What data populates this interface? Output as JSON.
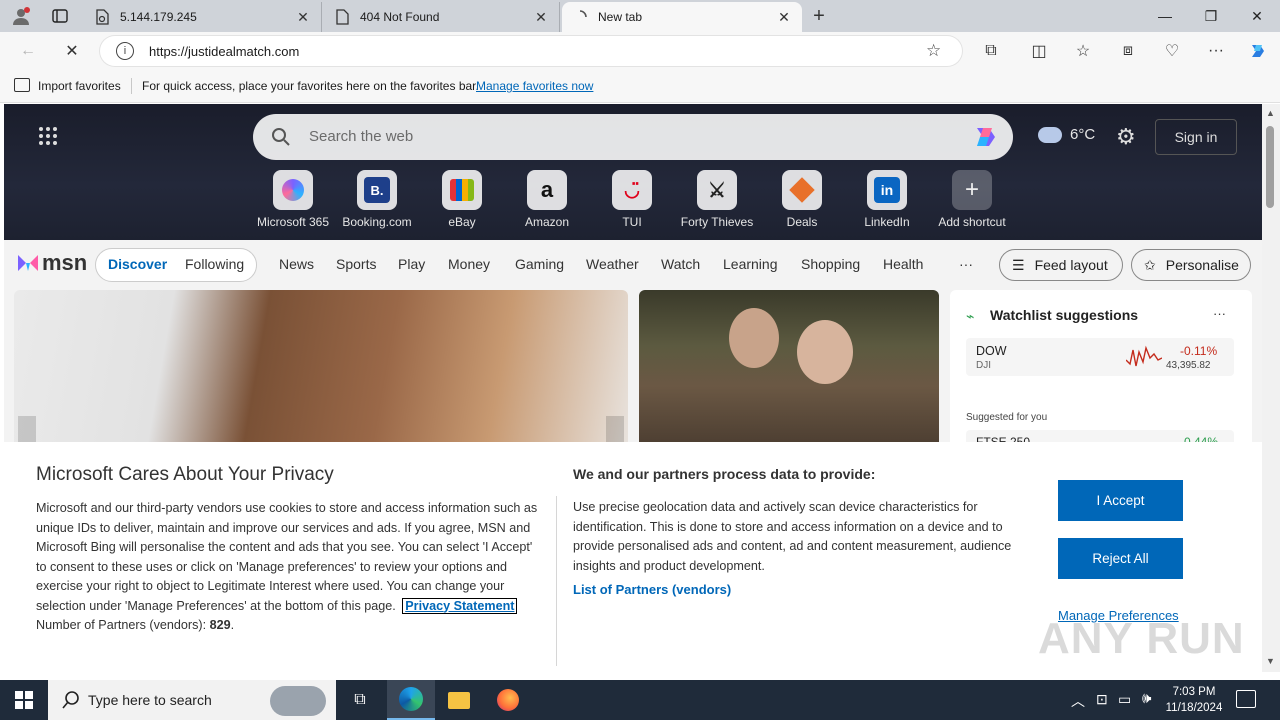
{
  "tabs": [
    {
      "label": "5.144.179.245"
    },
    {
      "label": "404 Not Found"
    },
    {
      "label": "New tab"
    }
  ],
  "toolbar": {
    "url": "https://justidealmatch.com"
  },
  "favorites_bar": {
    "import_label": "Import favorites",
    "hint": "For quick access, place your favorites here on the favorites bar.",
    "manage_link": "Manage favorites now"
  },
  "msn": {
    "search_placeholder": "Search the web",
    "weather_temp": "6°C",
    "sign_in": "Sign in",
    "shortcuts": [
      {
        "label": "Microsoft 365",
        "icon": "ms365-icon"
      },
      {
        "label": "Booking.com",
        "icon": "booking-icon"
      },
      {
        "label": "eBay",
        "icon": "ebay-icon"
      },
      {
        "label": "Amazon",
        "icon": "amazon-icon"
      },
      {
        "label": "TUI",
        "icon": "tui-icon"
      },
      {
        "label": "Forty Thieves",
        "icon": "forty-thieves-icon"
      },
      {
        "label": "Deals",
        "icon": "deals-icon"
      },
      {
        "label": "LinkedIn",
        "icon": "linkedin-icon"
      },
      {
        "label": "Add shortcut",
        "icon": "plus-icon"
      }
    ],
    "logo": "msn",
    "tabs": [
      "Discover",
      "Following"
    ],
    "nav": [
      "News",
      "Sports",
      "Play",
      "Money",
      "Gaming",
      "Weather",
      "Watch",
      "Learning",
      "Shopping",
      "Health"
    ],
    "more": "···",
    "feed_layout": "Feed layout",
    "personalise": "Personalise",
    "watchlist": {
      "title": "Watchlist suggestions",
      "more": "···",
      "stock_name": "DOW",
      "stock_ticker": "DJI",
      "stock_change": "-0.11%",
      "stock_value": "43,395.82",
      "suggested": "Suggested for you",
      "next_name": "FTSE 250",
      "next_change": "-0.44%"
    }
  },
  "consent": {
    "title": "Microsoft Cares About Your Privacy",
    "body": "Microsoft and our third-party vendors use cookies to store and access information such as unique IDs to deliver, maintain and improve our services and ads. If you agree, MSN and Microsoft Bing will personalise the content and ads that you see. You can select 'I Accept' to consent to these uses or click on 'Manage preferences' to review your options and exercise your right to object to Legitimate Interest where used.  You can change your selection under 'Manage Preferences' at the bottom of this page.",
    "privacy_link": "Privacy Statement",
    "partners_label": "Number of Partners (vendors): ",
    "partners_count": "829",
    "partners_suffix": ".",
    "purpose_title": "We and our partners process data to provide:",
    "purpose_body": "Use precise geolocation data and actively scan device characteristics for identification. This is done to store and access information on a device and to provide personalised ads and content, ad and content measurement, audience insights and product development.",
    "partners_link": "List of Partners (vendors)",
    "accept": "I Accept",
    "reject": "Reject All",
    "manage": "Manage Preferences"
  },
  "taskbar": {
    "search_placeholder": "Type here to search",
    "time": "7:03 PM",
    "date": "11/18/2024"
  },
  "watermark": "ANY RUN",
  "colors": {
    "accent": "#0067b8",
    "negative": "#c42b1c",
    "taskbar": "#1f2b3a"
  }
}
